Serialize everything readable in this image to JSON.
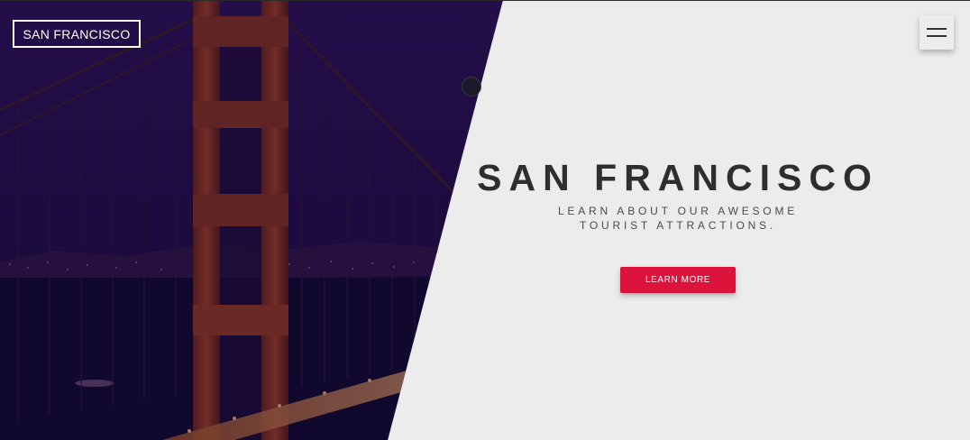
{
  "brand": {
    "label": "SAN FRANCISCO"
  },
  "hero": {
    "title": "SAN FRANCISCO",
    "subtitle": "LEARN ABOUT OUR AWESOME TOURIST ATTRACTIONS.",
    "cta_label": "LEARN MORE"
  },
  "icons": {
    "menu": "hamburger-menu-icon"
  },
  "colors": {
    "accent": "#dc143c",
    "background": "#ececec",
    "text_dark": "#2e2e2e",
    "photo_overlay": "#1e0c3c"
  }
}
